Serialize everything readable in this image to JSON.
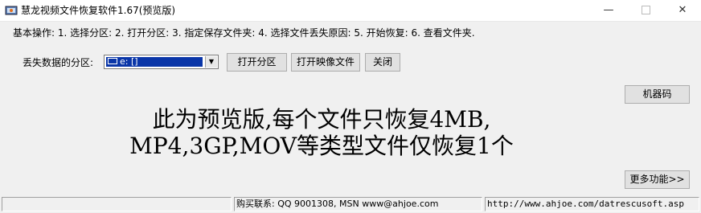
{
  "window": {
    "title": "慧龙视频文件恢复软件1.67(预览版)",
    "min_glyph": "—",
    "close_glyph": "✕"
  },
  "steps": {
    "text": "基本操作: 1. 选择分区: 2. 打开分区: 3. 指定保存文件夹: 4. 选择文件丢失原因: 5. 开始恢复: 6. 查看文件夹."
  },
  "partition": {
    "label": "丢失数据的分区:",
    "selected": "e: []",
    "icon": "drive-icon"
  },
  "buttons": {
    "open_partition": "打开分区",
    "open_image": "打开映像文件",
    "close": "关闭",
    "machine_code": "机器码",
    "more": "更多功能>>"
  },
  "notice": {
    "line1": "此为预览版,每个文件只恢复4MB,",
    "line2": "MP4,3GP,MOV等类型文件仅恢复1个"
  },
  "status": {
    "panel1": "",
    "panel2": "购买联系: QQ 9001308, MSN www@ahjoe.com",
    "panel3": "http://www.ahjoe.com/datrescusoft.asp"
  }
}
